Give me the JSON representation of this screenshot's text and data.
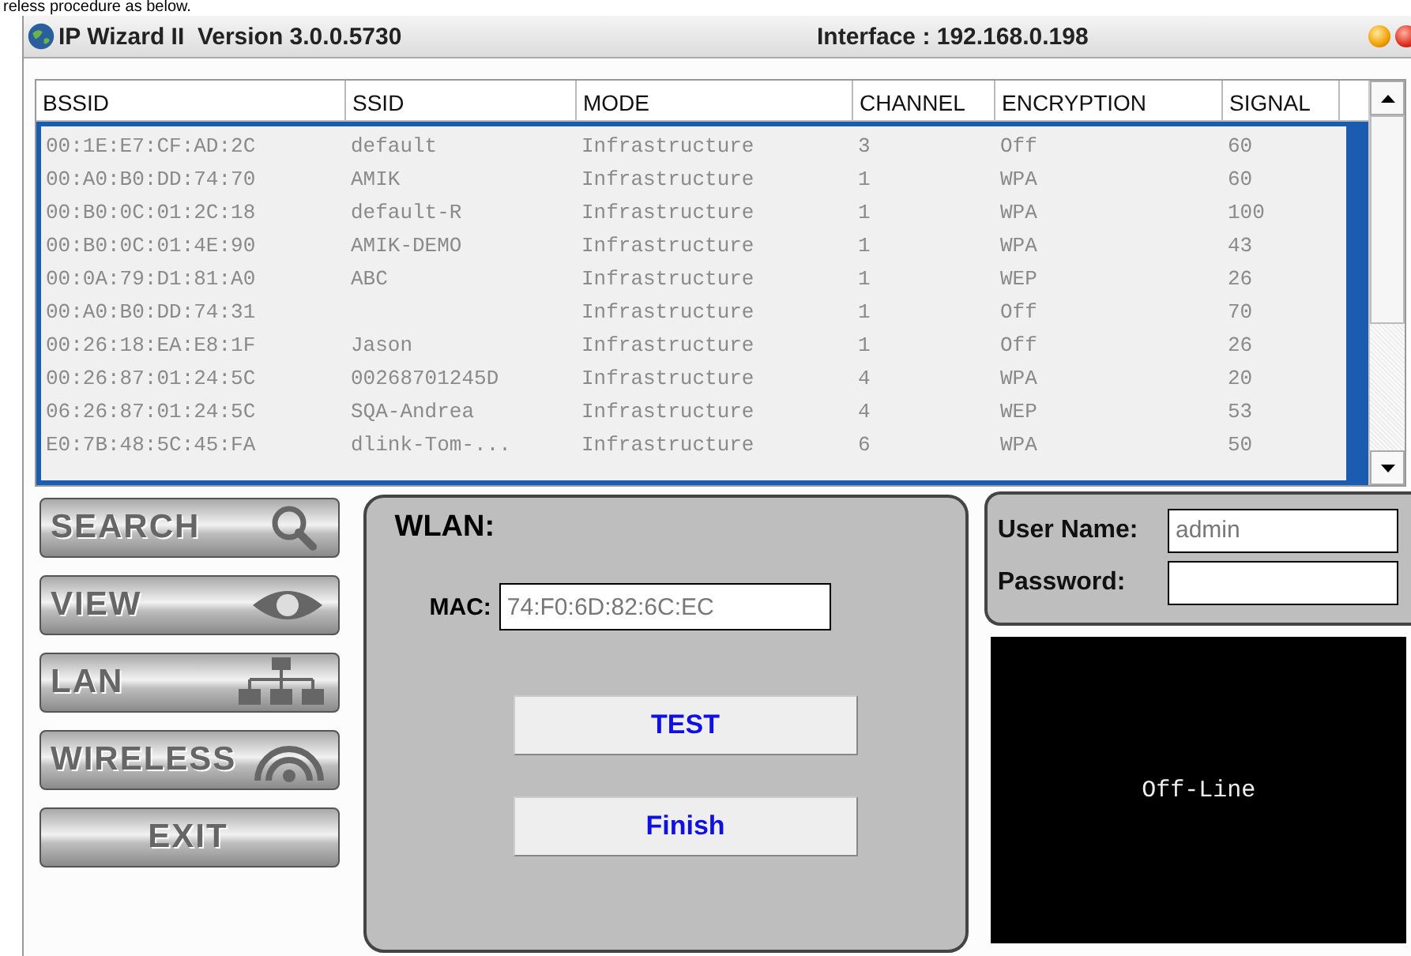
{
  "caption": "reless procedure as below.",
  "window": {
    "title": "IP Wizard II  Version 3.0.0.5730",
    "interface": "Interface : 192.168.0.198"
  },
  "table": {
    "columns": [
      "BSSID",
      "SSID",
      "MODE",
      "CHANNEL",
      "ENCRYPTION",
      "SIGNAL"
    ],
    "rows": [
      [
        "00:1E:E7:CF:AD:2C",
        "default",
        "Infrastructure",
        "3",
        "Off",
        "60"
      ],
      [
        "00:A0:B0:DD:74:70",
        "AMIK",
        "Infrastructure",
        "1",
        "WPA",
        "60"
      ],
      [
        "00:B0:0C:01:2C:18",
        "default-R",
        "Infrastructure",
        "1",
        "WPA",
        "100"
      ],
      [
        "00:B0:0C:01:4E:90",
        "AMIK-DEMO",
        "Infrastructure",
        "1",
        "WPA",
        "43"
      ],
      [
        "00:0A:79:D1:81:A0",
        "ABC",
        "Infrastructure",
        "1",
        "WEP",
        "26"
      ],
      [
        "00:A0:B0:DD:74:31",
        "",
        "Infrastructure",
        "1",
        "Off",
        "70"
      ],
      [
        "00:26:18:EA:E8:1F",
        "Jason",
        "Infrastructure",
        "1",
        "Off",
        "26"
      ],
      [
        "00:26:87:01:24:5C",
        "00268701245D",
        "Infrastructure",
        "4",
        "WPA",
        "20"
      ],
      [
        "06:26:87:01:24:5C",
        "SQA-Andrea",
        "Infrastructure",
        "4",
        "WEP",
        "53"
      ],
      [
        "E0:7B:48:5C:45:FA",
        "dlink-Tom-...",
        "Infrastructure",
        "6",
        "WPA",
        "50"
      ]
    ]
  },
  "nav": [
    {
      "label": "SEARCH",
      "kind": "search"
    },
    {
      "label": "VIEW",
      "kind": "view"
    },
    {
      "label": "LAN",
      "kind": "lan"
    },
    {
      "label": "WIRELESS",
      "kind": "wireless"
    },
    {
      "label": "EXIT",
      "kind": "exit"
    }
  ],
  "wlan": {
    "title": "WLAN:",
    "mac_label": "MAC:",
    "mac": "74:F0:6D:82:6C:EC",
    "buttons": [
      "TEST",
      "Finish"
    ]
  },
  "login": {
    "user_label": "User Name:",
    "user": "admin",
    "password_label": "Password:"
  },
  "status": "Off-Line"
}
